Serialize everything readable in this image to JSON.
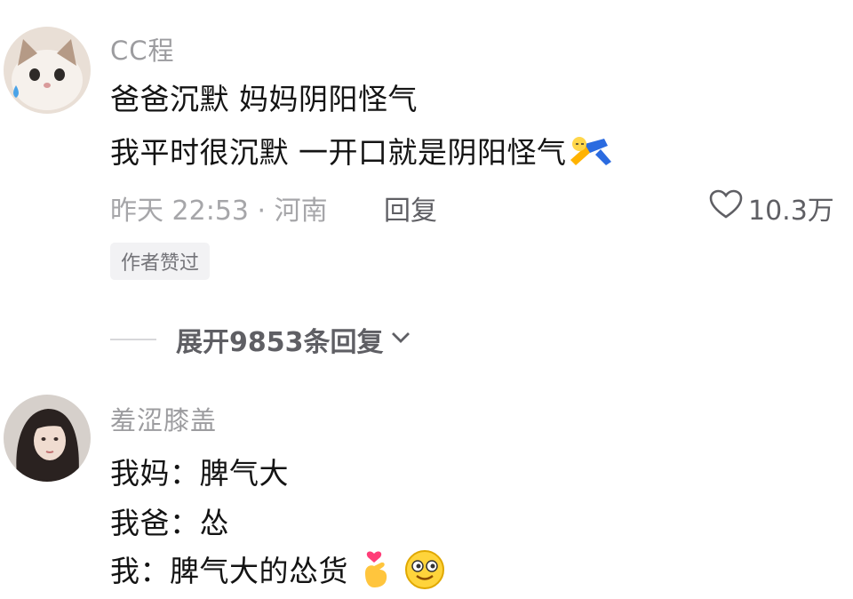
{
  "comments": [
    {
      "username": "CC程",
      "lines": [
        "爸爸沉默 妈妈阴阳怪气",
        "我平时很沉默 一开口就是阴阳怪气"
      ],
      "trailing_icon": "falling-person-emoji",
      "meta": "昨天 22:53 · 河南",
      "reply_label": "回复",
      "likes": "10.3万",
      "badge": "作者赞过",
      "expand_label": "展开9853条回复"
    },
    {
      "username": "羞涩膝盖",
      "lines": [
        "我妈：脾气大",
        "我爸：怂",
        "我：脾气大的怂货"
      ],
      "trailing_icons": [
        "finger-heart-emoji",
        "smiling-face-emoji"
      ]
    }
  ],
  "colors": {
    "username": "#9c9c9f",
    "body_text": "#141414",
    "meta_text": "#a6a6a9",
    "action_text": "#5f5f64",
    "badge_bg": "#f2f2f4"
  }
}
